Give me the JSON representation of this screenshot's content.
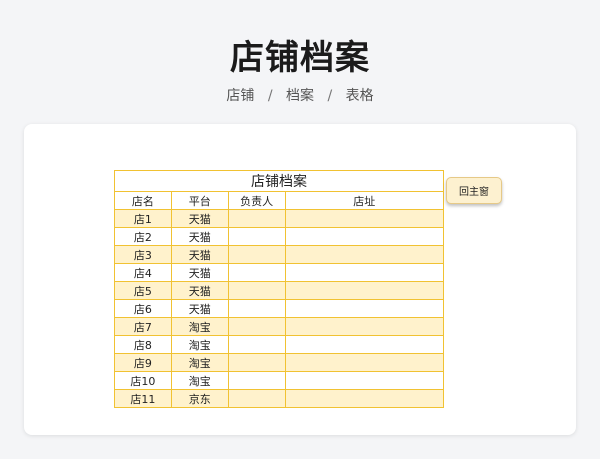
{
  "page": {
    "title": "店铺档案",
    "breadcrumb": [
      "店铺",
      "档案",
      "表格"
    ],
    "breadcrumb_separator": "/"
  },
  "sheet": {
    "title": "店铺档案",
    "headers": [
      "店名",
      "平台",
      "负责人",
      "店址"
    ],
    "rows": [
      [
        "店1",
        "天猫",
        "",
        ""
      ],
      [
        "店2",
        "天猫",
        "",
        ""
      ],
      [
        "店3",
        "天猫",
        "",
        ""
      ],
      [
        "店4",
        "天猫",
        "",
        ""
      ],
      [
        "店5",
        "天猫",
        "",
        ""
      ],
      [
        "店6",
        "天猫",
        "",
        ""
      ],
      [
        "店7",
        "淘宝",
        "",
        ""
      ],
      [
        "店8",
        "淘宝",
        "",
        ""
      ],
      [
        "店9",
        "淘宝",
        "",
        ""
      ],
      [
        "店10",
        "淘宝",
        "",
        ""
      ],
      [
        "店11",
        "京东",
        "",
        ""
      ]
    ]
  },
  "home_button": {
    "label": "回主窗"
  },
  "colors": {
    "header_fill": "#ffc000",
    "band_fill": "#fff2cc",
    "grid_line": "#f1c232"
  }
}
